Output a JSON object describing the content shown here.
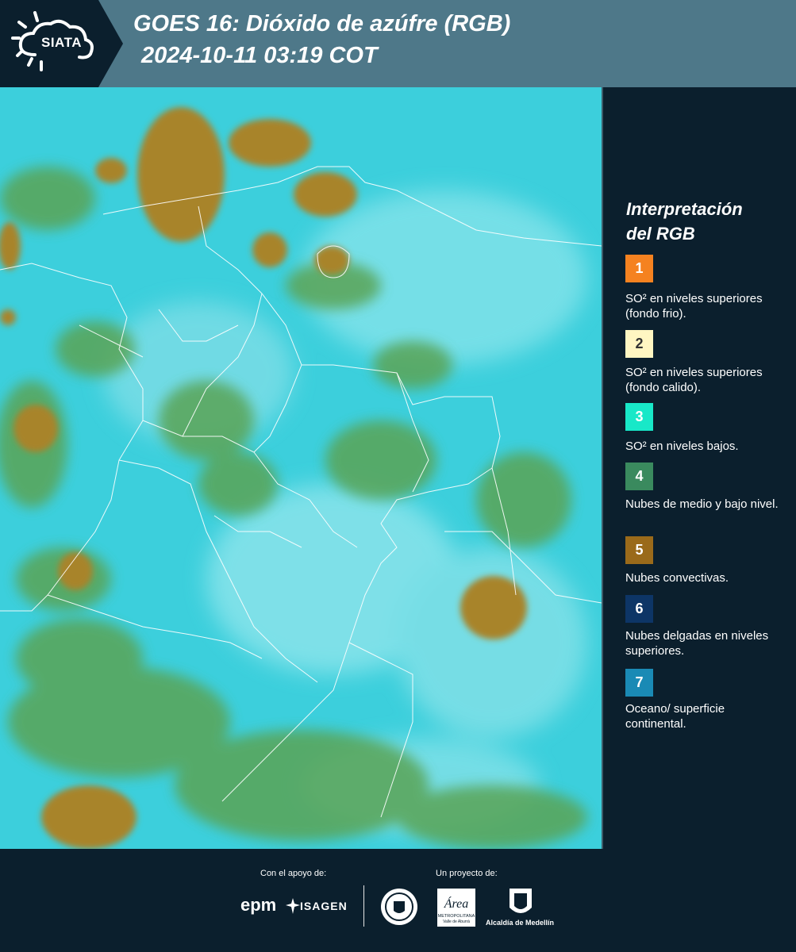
{
  "header": {
    "logo_text": "SIATA",
    "title_line1": "GOES 16: Dióxido de azúfre (RGB)",
    "title_line2": "2024-10-11 03:19 COT"
  },
  "legend": {
    "title_line1": "Interpretación",
    "title_line2": "del RGB",
    "items": [
      {
        "number": "1",
        "color": "#f58220",
        "text": "SO² en niveles superiores (fondo frio)."
      },
      {
        "number": "2",
        "color": "#fff6c2",
        "text": "SO² en niveles superiores (fondo calido)."
      },
      {
        "number": "3",
        "color": "#18e8c8",
        "text": "SO² en niveles bajos."
      },
      {
        "number": "4",
        "color": "#3a8a5e",
        "text": "Nubes de medio y bajo nivel."
      },
      {
        "number": "5",
        "color": "#9a6a1a",
        "text": "Nubes convectivas."
      },
      {
        "number": "6",
        "color": "#0d3566",
        "text": "Nubes delgadas en niveles superiores."
      },
      {
        "number": "7",
        "color": "#1a8ab5",
        "text": "Oceano/ superficie continental."
      }
    ]
  },
  "footer": {
    "support_label": "Con el apoyo de:",
    "project_label": "Un proyecto de:",
    "sponsor1": "epm",
    "sponsor2": "ISAGEN",
    "partner_area_name": "Área",
    "partner_area_sub": "METROPOLITANA",
    "partner_area_sub2": "Valle de Aburrá",
    "partner_alcaldia": "Alcaldía de Medellín"
  },
  "colors": {
    "background": "#0b1f2d",
    "header_band": "#4e7889",
    "map_cyan": "#3fd2df",
    "map_green": "#5aa456",
    "map_brown": "#a8842c"
  }
}
